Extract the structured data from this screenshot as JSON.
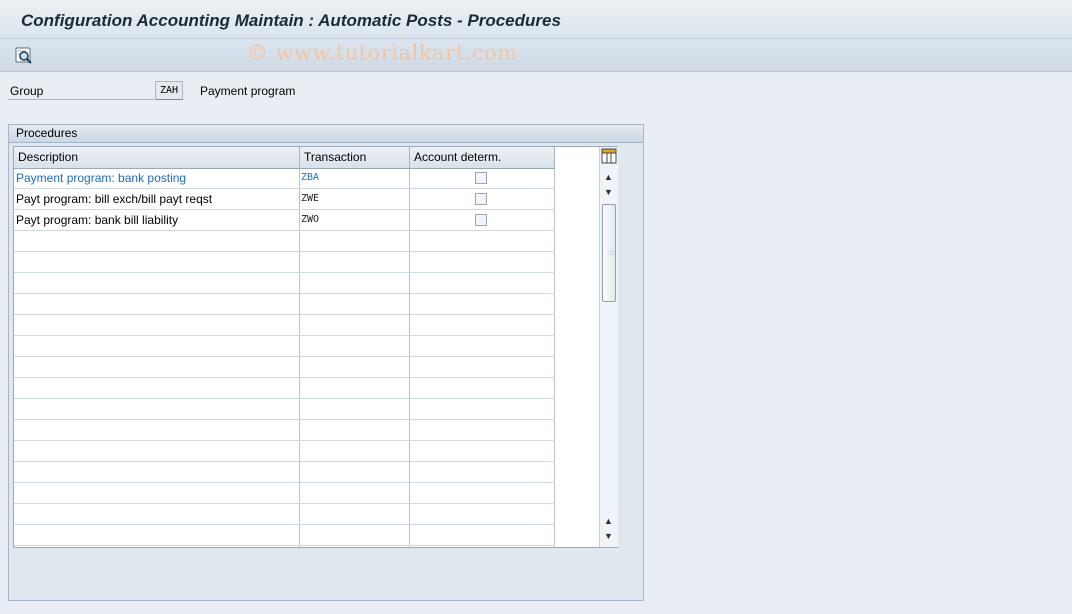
{
  "window": {
    "title": "Configuration Accounting Maintain : Automatic Posts - Procedures",
    "watermark": "© www.tutorialkart.com"
  },
  "toolbar": {
    "buttons": [
      {
        "icon": "find-magnifier-icon"
      }
    ]
  },
  "group": {
    "label": "Group",
    "value": "ZAH",
    "description": "Payment program"
  },
  "procedures": {
    "title": "Procedures",
    "columns": [
      "Description",
      "Transaction",
      "Account determ."
    ],
    "rows": [
      {
        "description": "Payment program: bank posting",
        "transaction": "ZBA",
        "account_determ": false,
        "selected": true
      },
      {
        "description": "Payt program: bill exch/bill payt reqst",
        "transaction": "ZWE",
        "account_determ": false,
        "selected": false
      },
      {
        "description": "Payt program: bank bill liability",
        "transaction": "ZWO",
        "account_determ": false,
        "selected": false
      }
    ],
    "empty_rows": 15
  },
  "colors": {
    "selected_text": "#1f6cc4",
    "header_bg": "#dde5ed",
    "background": "#e9eef4"
  }
}
